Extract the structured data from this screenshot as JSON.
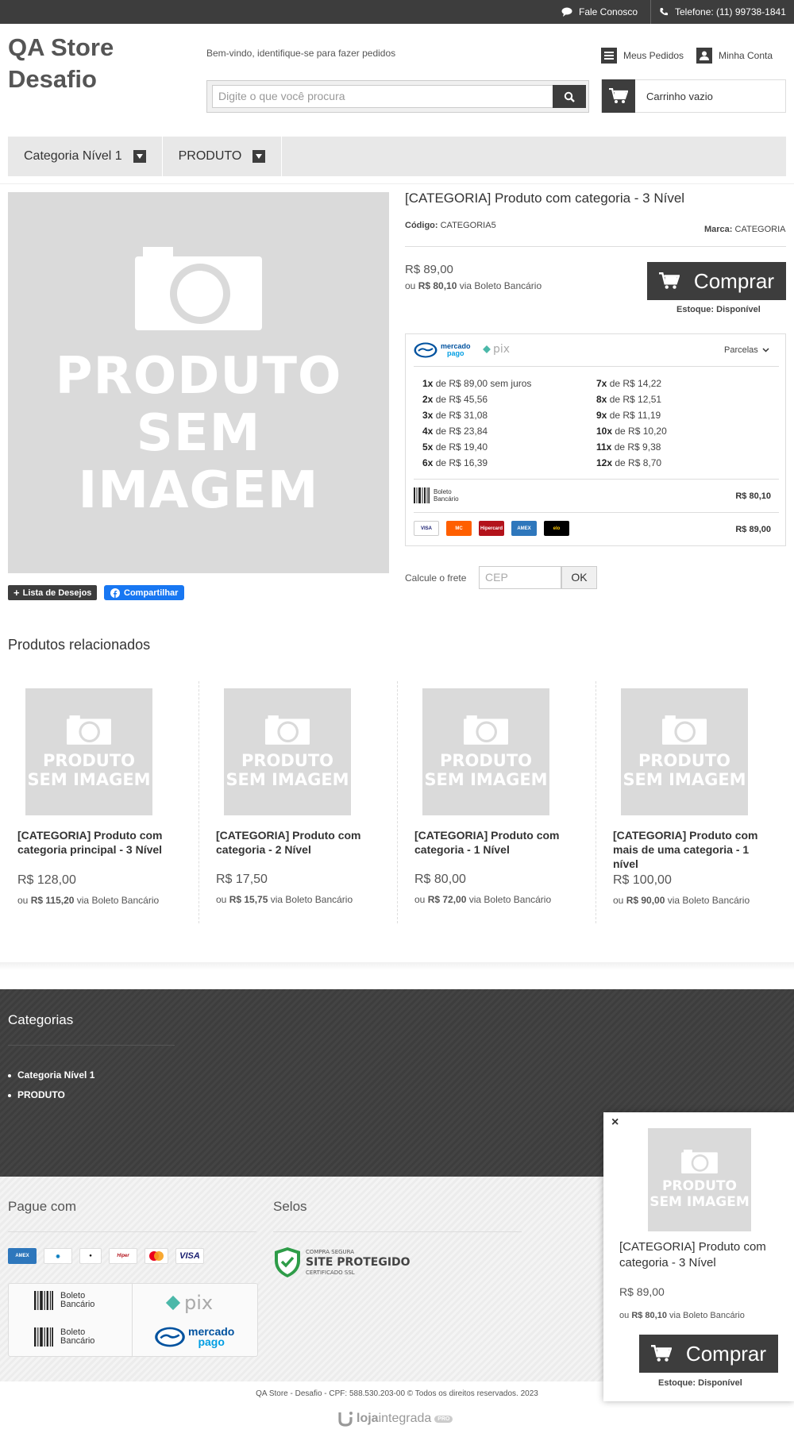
{
  "topbar": {
    "contact": "Fale Conosco",
    "phone": "Telefone: (11) 99738-1841"
  },
  "header": {
    "store_name": "QA Store Desafio",
    "welcome": "Bem-vindo, identifique-se para fazer pedidos",
    "search_placeholder": "Digite o que você procura",
    "orders": "Meus Pedidos",
    "account": "Minha Conta",
    "cart": "Carrinho vazio"
  },
  "nav": {
    "items": [
      "Categoria Nível 1",
      "PRODUTO"
    ]
  },
  "product": {
    "image_text_1": "PRODUTO",
    "image_text_2": "SEM IMAGEM",
    "title": "[CATEGORIA] Produto com categoria - 3 Nível",
    "code_label": "Código:",
    "code": "CATEGORIA5",
    "brand_label": "Marca:",
    "brand": "CATEGORIA",
    "price": "R$ 89,00",
    "boleto_prefix": "ou",
    "boleto_price": "R$ 80,10",
    "boleto_suffix": "via Boleto Bancário",
    "buy": "Comprar",
    "stock_label": "Estoque:",
    "stock": "Disponível",
    "wishlist": "Lista de Desejos",
    "share": "Compartilhar"
  },
  "payment": {
    "mp_logo_1": "mercado",
    "mp_logo_2": "pago",
    "pix": "pix",
    "installments_label": "Parcelas",
    "installments_left": [
      {
        "n": "1x",
        "text": "de R$ 89,00 sem juros"
      },
      {
        "n": "2x",
        "text": "de R$ 45,56"
      },
      {
        "n": "3x",
        "text": "de R$ 31,08"
      },
      {
        "n": "4x",
        "text": "de R$ 23,84"
      },
      {
        "n": "5x",
        "text": "de R$ 19,40"
      },
      {
        "n": "6x",
        "text": "de R$ 16,39"
      }
    ],
    "installments_right": [
      {
        "n": "7x",
        "text": "de R$ 14,22"
      },
      {
        "n": "8x",
        "text": "de R$ 12,51"
      },
      {
        "n": "9x",
        "text": "de R$ 11,19"
      },
      {
        "n": "10x",
        "text": "de R$ 10,20"
      },
      {
        "n": "11x",
        "text": "de R$ 9,38"
      },
      {
        "n": "12x",
        "text": "de R$ 8,70"
      }
    ],
    "boleto_label_1": "Boleto",
    "boleto_label_2": "Bancário",
    "boleto_price": "R$ 80,10",
    "cards_price": "R$ 89,00",
    "cards": [
      {
        "name": "VISA",
        "color": "#ffffff",
        "text": "#1a1f71"
      },
      {
        "name": "MC",
        "color": "#ff5f00",
        "text": "#ffffff"
      },
      {
        "name": "Hipercard",
        "color": "#b3131b",
        "text": "#ffffff"
      },
      {
        "name": "AMEX",
        "color": "#2e77bc",
        "text": "#ffffff"
      },
      {
        "name": "elo",
        "color": "#000000",
        "text": "#ffcb05"
      }
    ]
  },
  "shipping": {
    "label": "Calcule o frete",
    "placeholder": "CEP",
    "button": "OK"
  },
  "related": {
    "title": "Produtos relacionados",
    "items": [
      {
        "name": "[CATEGORIA] Produto com categoria principal - 3 Nível",
        "price": "R$ 128,00",
        "boleto": "R$ 115,20"
      },
      {
        "name": "[CATEGORIA] Produto com categoria - 2 Nível",
        "price": "R$ 17,50",
        "boleto": "R$ 15,75"
      },
      {
        "name": "[CATEGORIA] Produto com categoria - 1 Nível",
        "price": "R$ 80,00",
        "boleto": "R$ 72,00"
      },
      {
        "name": "[CATEGORIA] Produto com mais de uma categoria - 1 nível",
        "price": "R$ 100,00",
        "boleto": "R$ 90,00"
      }
    ],
    "or": "ou",
    "via": "via Boleto Bancário"
  },
  "footer": {
    "categories_title": "Categorias",
    "categories": [
      "Categoria Nível 1",
      "PRODUTO"
    ],
    "pay_title": "Pague com",
    "seals_title": "Selos",
    "seal_1": "COMPRA SEGURA",
    "seal_2": "SITE PROTEGIDO",
    "seal_3": "CERTIFICADO SSL",
    "copyright": "QA Store - Desafio - CPF: 588.530.203-00 © Todos os direitos reservados. 2023",
    "platform_1": "loja",
    "platform_2": "integrada",
    "platform_badge": "PRO"
  },
  "popup": {
    "close": "×",
    "title": "[CATEGORIA] Produto com categoria - 3 Nível",
    "price": "R$ 89,00",
    "boleto_prefix": "ou",
    "boleto_price": "R$ 80,10",
    "boleto_suffix": "via Boleto Bancário",
    "buy": "Comprar",
    "stock_label": "Estoque:",
    "stock": "Disponível"
  },
  "colors": {
    "dark": "#3d3d3d",
    "placeholder_bg": "#dadada",
    "facebook": "#1877f2"
  }
}
